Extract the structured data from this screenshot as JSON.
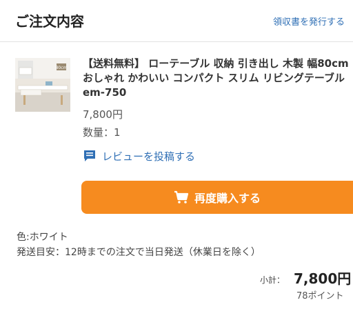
{
  "header": {
    "title": "ご注文内容",
    "receipt_link": "領収書を発行する"
  },
  "product": {
    "thumbnail_badge": "80cm",
    "name": "【送料無料】 ローテーブル 収納 引き出し 木製 幅80cm おしゃれ かわいい コンパクト スリム リビングテーブル em-750",
    "price": "7,800円",
    "quantity": "数量：1"
  },
  "actions": {
    "review_label": "レビューを投稿する",
    "review_icon": "review-icon",
    "rebuy_label": "再度購入する",
    "rebuy_icon": "cart-icon"
  },
  "details": {
    "color": "色:ホワイト",
    "shipping": "発送目安：12時までの注文で当日発送（休業日を除く）"
  },
  "totals": {
    "subtotal_label": "小計：",
    "subtotal_value": "7,800円",
    "points": "78ポイント"
  },
  "colors": {
    "accent_orange": "#f68b1f",
    "link_blue": "#2f6fb5"
  }
}
